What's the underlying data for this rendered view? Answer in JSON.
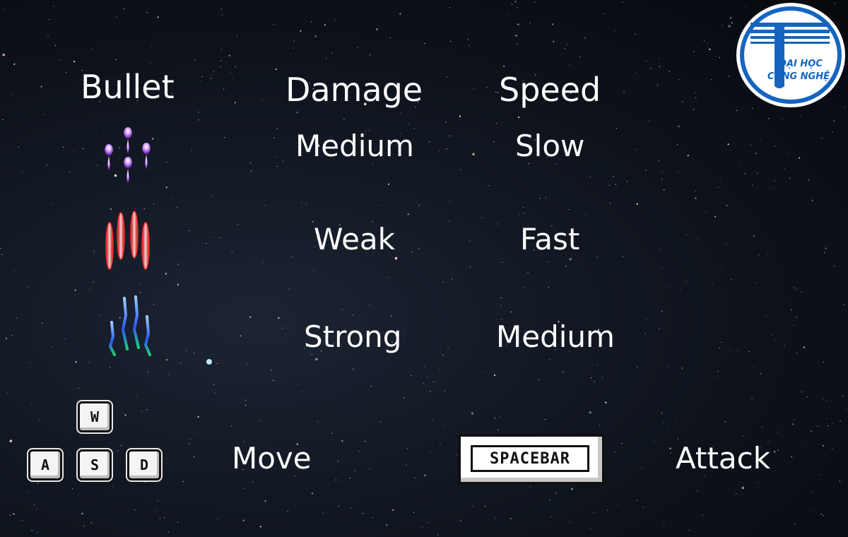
{
  "headers": {
    "bullet": "Bullet",
    "damage": "Damage",
    "speed": "Speed"
  },
  "bullets": [
    {
      "icon": "purple-bullet-icon",
      "color": "#b070ff",
      "damage": "Medium",
      "speed": "Slow"
    },
    {
      "icon": "red-bullet-icon",
      "color": "#ff3b3b",
      "damage": "Weak",
      "speed": "Fast"
    },
    {
      "icon": "blue-bullet-icon",
      "color": "#3a6cff",
      "damage": "Strong",
      "speed": "Medium"
    }
  ],
  "controls": {
    "keys": {
      "w": "W",
      "a": "A",
      "s": "S",
      "d": "D"
    },
    "move_label": "Move",
    "spacebar": "SPACEBAR",
    "attack_label": "Attack"
  },
  "logo": {
    "line1": "ĐẠI HỌC",
    "line2": "CÔNG NGHỆ",
    "color": "#1565c0"
  }
}
